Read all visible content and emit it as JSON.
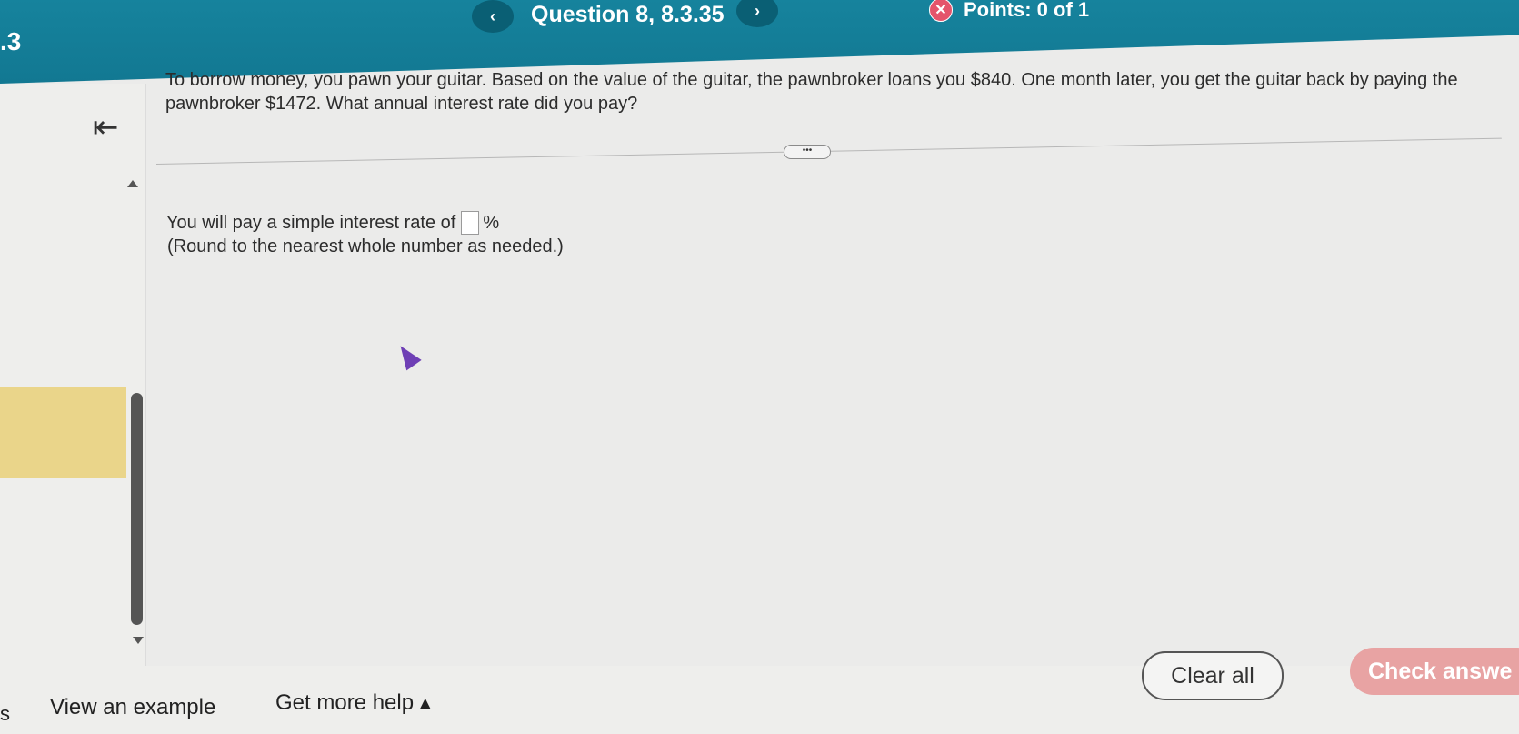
{
  "header": {
    "section": ".3",
    "prev_label": "‹",
    "next_label": "›",
    "question_title": "Question 8, 8.3.35",
    "points_label": "Points: 0 of 1",
    "points_icon": "x-circle-icon"
  },
  "sidebar": {
    "collapse_icon": "collapse-left-icon"
  },
  "question": {
    "prompt": "To borrow money, you pawn your guitar. Based on the value of the guitar, the pawnbroker loans you $840. One month later, you get the guitar back by paying the pawnbroker $1472. What annual interest rate did you pay?",
    "more_label": "•••",
    "answer_prefix": "You will pay a simple interest rate of",
    "answer_value": "",
    "answer_suffix": "%",
    "instruction": "(Round to the nearest whole number as needed.)"
  },
  "footer": {
    "left_label": "s",
    "view_example": "View an example",
    "get_help": "Get more help ▴",
    "clear_all": "Clear all",
    "check_answer": "Check answe"
  },
  "colors": {
    "header": "#16839d",
    "highlight": "#ead58a",
    "check_button": "#e8a3a3",
    "points_icon": "#e4546b"
  }
}
